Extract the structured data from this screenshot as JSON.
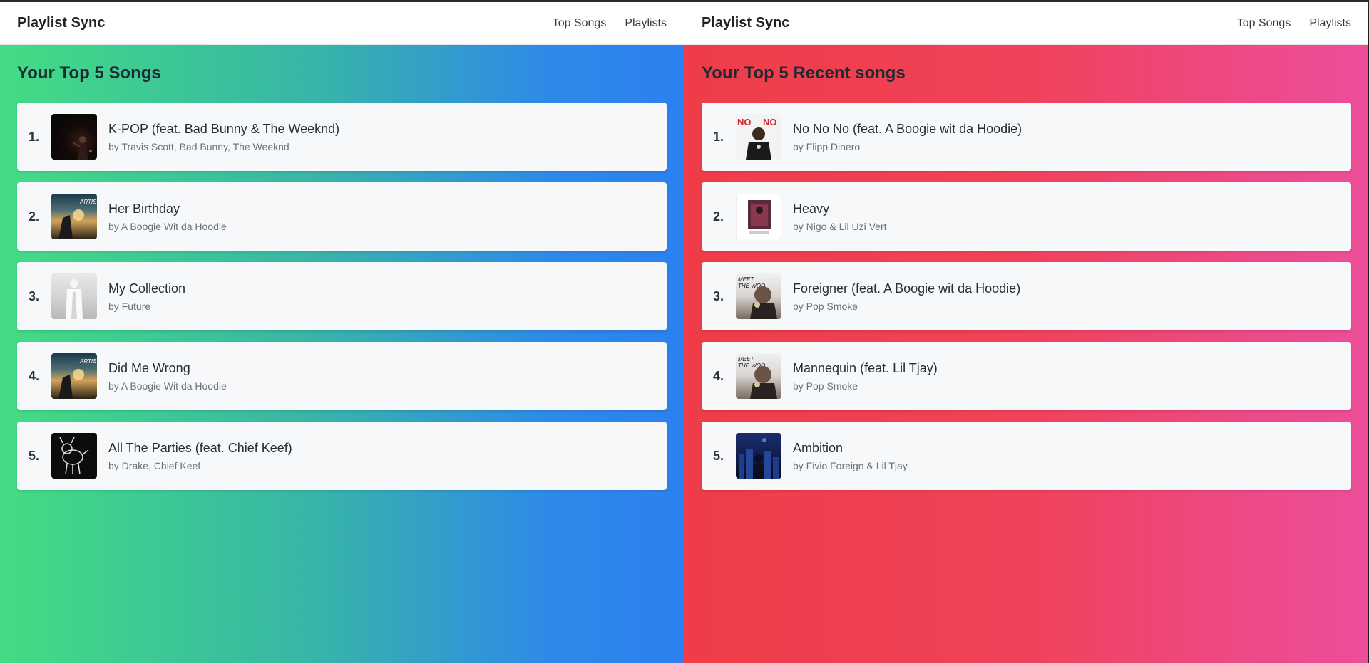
{
  "left": {
    "nav": {
      "brand": "Playlist Sync",
      "links": [
        "Top Songs",
        "Playlists"
      ]
    },
    "heading": "Your Top 5 Songs",
    "songs": [
      {
        "rank": "1.",
        "title": "K-POP (feat. Bad Bunny & The Weeknd)",
        "artist": "by Travis Scott, Bad Bunny, The Weeknd",
        "art": "dark-concert-art"
      },
      {
        "rank": "2.",
        "title": "Her Birthday",
        "artist": "by A Boogie Wit da Hoodie",
        "art": "sunset-album-art"
      },
      {
        "rank": "3.",
        "title": "My Collection",
        "artist": "by Future",
        "art": "white-figure-art"
      },
      {
        "rank": "4.",
        "title": "Did Me Wrong",
        "artist": "by A Boogie Wit da Hoodie",
        "art": "sunset-album-art"
      },
      {
        "rank": "5.",
        "title": "All The Parties (feat. Chief Keef)",
        "artist": "by Drake, Chief Keef",
        "art": "dog-drawing-art"
      }
    ]
  },
  "right": {
    "nav": {
      "brand": "Playlist Sync",
      "links": [
        "Top Songs",
        "Playlists"
      ]
    },
    "heading": "Your Top 5 Recent songs",
    "songs": [
      {
        "rank": "1.",
        "title": "No No No (feat. A Boogie wit da Hoodie)",
        "artist": "by Flipp Dinero",
        "art": "no-no-art"
      },
      {
        "rank": "2.",
        "title": "Heavy",
        "artist": "by Nigo & Lil Uzi Vert",
        "art": "heavy-art"
      },
      {
        "rank": "3.",
        "title": "Foreigner (feat. A Boogie wit da Hoodie)",
        "artist": "by Pop Smoke",
        "art": "pop-smoke-art"
      },
      {
        "rank": "4.",
        "title": "Mannequin (feat. Lil Tjay)",
        "artist": "by Pop Smoke",
        "art": "pop-smoke-art"
      },
      {
        "rank": "5.",
        "title": "Ambition",
        "artist": "by Fivio Foreign & Lil Tjay",
        "art": "blue-city-art"
      }
    ]
  },
  "colors": {
    "left_gradient_start": "#43dc83",
    "left_gradient_end": "#2c80ef",
    "right_gradient_start": "#ef3c48",
    "right_gradient_end": "#ec4e99",
    "card_bg": "#f7f8fa"
  },
  "art_lettering": {
    "no_no": "NO NO",
    "mvp": "MEET THE WOO"
  }
}
